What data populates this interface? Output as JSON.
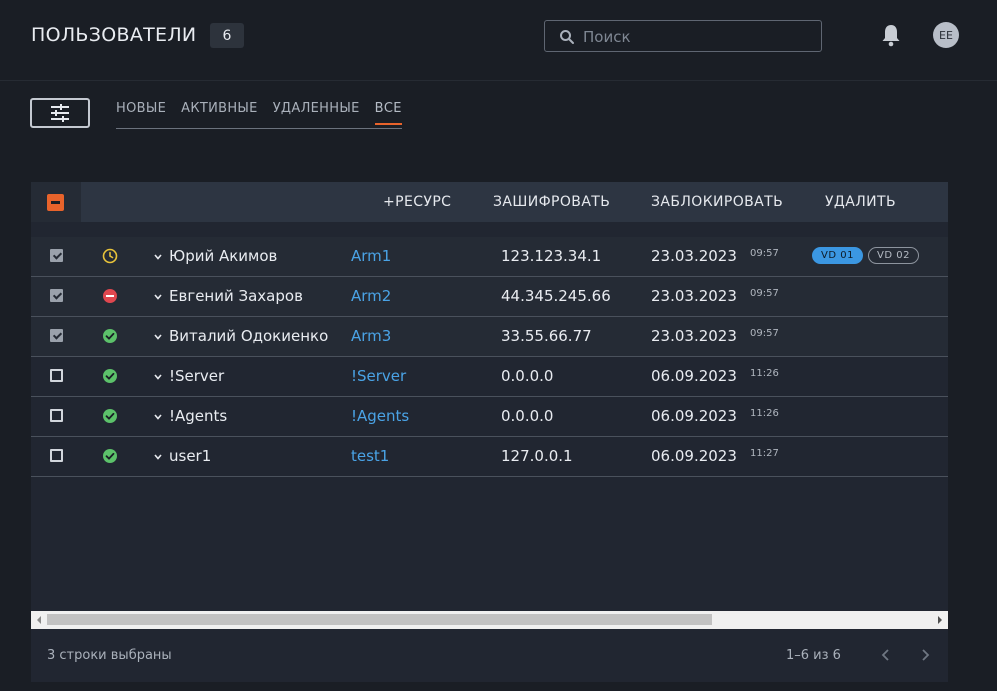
{
  "header": {
    "title": "ПОЛЬЗОВАТЕЛИ",
    "count": "6",
    "search_placeholder": "Поиск",
    "avatar_initials": "EE"
  },
  "tabs": [
    {
      "label": "НОВЫЕ",
      "active": false
    },
    {
      "label": "АКТИВНЫЕ",
      "active": false
    },
    {
      "label": "УДАЛЕННЫЕ",
      "active": false
    },
    {
      "label": "ВСЕ",
      "active": true
    }
  ],
  "actions": {
    "add_resource": "+РЕСУРС",
    "encrypt": "ЗАШИФРОВАТЬ",
    "block": "ЗАБЛОКИРОВАТЬ",
    "delete": "УДАЛИТЬ"
  },
  "rows": [
    {
      "checked": true,
      "status": "pending",
      "name": "Юрий Акимов",
      "arm": "Arm1",
      "ip": "123.123.34.1",
      "date": "23.03.2023",
      "time": "09:57",
      "tags": [
        "VD 01",
        "VD 02"
      ]
    },
    {
      "checked": true,
      "status": "blocked",
      "name": "Евгений Захаров",
      "arm": "Arm2",
      "ip": "44.345.245.66",
      "date": "23.03.2023",
      "time": "09:57",
      "tags": []
    },
    {
      "checked": true,
      "status": "active",
      "name": "Виталий Одокиенко",
      "arm": "Arm3",
      "ip": "33.55.66.77",
      "date": "23.03.2023",
      "time": "09:57",
      "tags": []
    },
    {
      "checked": false,
      "status": "active",
      "name": "!Server",
      "arm": "!Server",
      "ip": "0.0.0.0",
      "date": "06.09.2023",
      "time": "11:26",
      "tags": []
    },
    {
      "checked": false,
      "status": "active",
      "name": "!Agents",
      "arm": "!Agents",
      "ip": "0.0.0.0",
      "date": "06.09.2023",
      "time": "11:26",
      "tags": []
    },
    {
      "checked": false,
      "status": "active",
      "name": "user1",
      "arm": "test1",
      "ip": "127.0.0.1",
      "date": "06.09.2023",
      "time": "11:27",
      "tags": []
    }
  ],
  "status_colors": {
    "pending": "#e8c33a",
    "blocked": "#e0474f",
    "active": "#5cc16a"
  },
  "accent": "#e8632b",
  "link_color": "#4aa3e6",
  "footer": {
    "selection_text": "3 строки выбраны",
    "range_text": "1–6 из 6"
  }
}
